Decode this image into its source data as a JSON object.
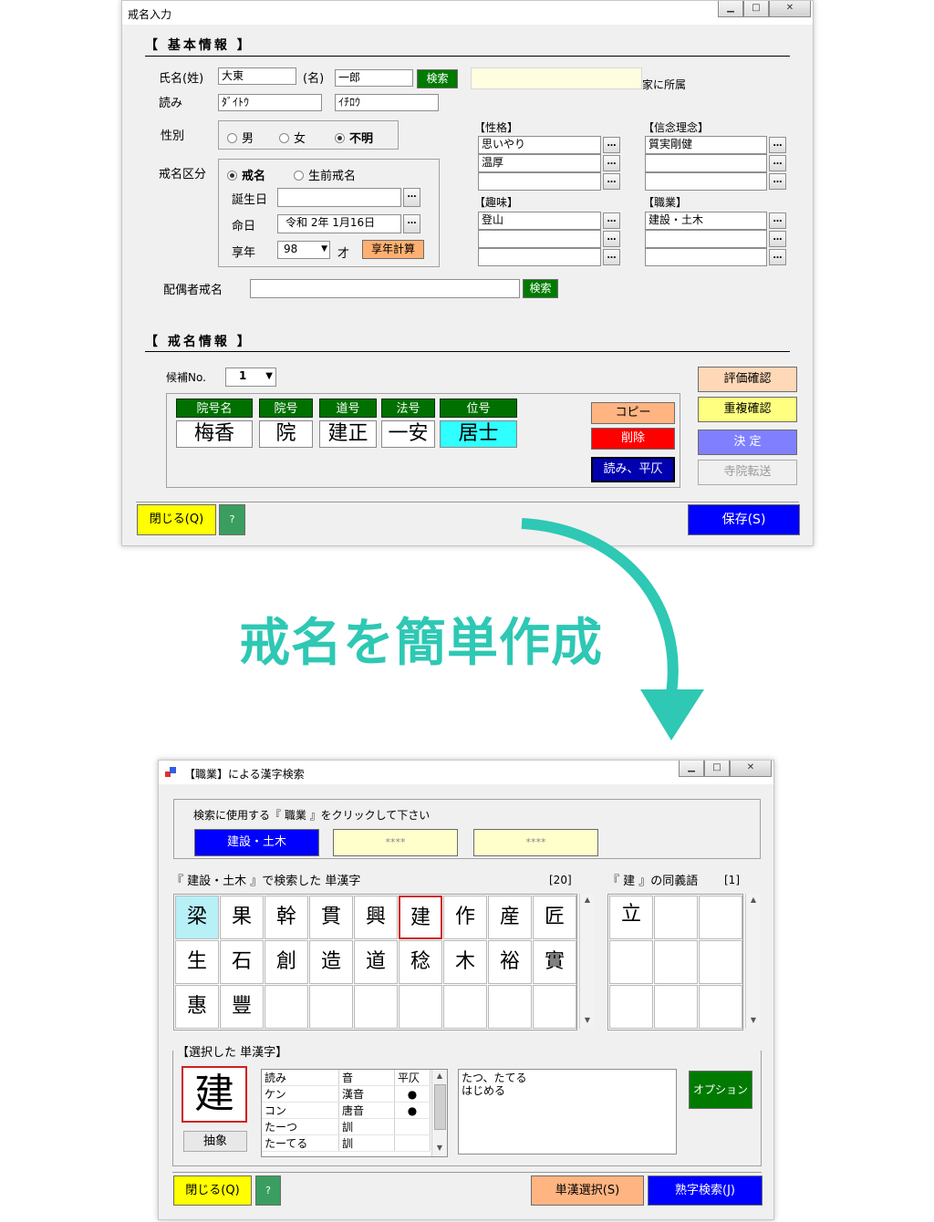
{
  "win1": {
    "title": "戒名入力",
    "basic_section": "【 基本情報 】",
    "name_label": "氏名(姓)",
    "surname": "大東",
    "given_label": "(名)",
    "given": "一郎",
    "search_label": "検索",
    "family_belong_suffix": "家に所属",
    "yomi_label": "読み",
    "surname_yomi": "ﾀﾞｲﾄｳ",
    "given_yomi": "ｲﾁﾛｳ",
    "gender_label": "性別",
    "gender_options": [
      "男",
      "女",
      "不明"
    ],
    "kaimyo_type_label": "戒名区分",
    "kaimyo_type_options": [
      "戒名",
      "生前戒名"
    ],
    "birthday_label": "誕生日",
    "birthday": "",
    "death_label": "命日",
    "death_date": "令和 2年 1月16日",
    "age_label": "享年",
    "age": "98",
    "age_unit": "才",
    "age_calc_label": "享年計算",
    "spouse_label": "配偶者戒名",
    "spouse_value": "",
    "seikaku_label": "【性格】",
    "seikaku": [
      "思いやり",
      "温厚",
      ""
    ],
    "shinnen_label": "【信念理念】",
    "shinnen": [
      "質実剛健",
      "",
      ""
    ],
    "shumi_label": "【趣味】",
    "shumi": [
      "登山",
      "",
      ""
    ],
    "shokugyo_label": "【職業】",
    "shokugyo": [
      "建設・土木",
      "",
      ""
    ],
    "ellipsis": "…",
    "kaimyo_section": "【 戒名情報 】",
    "candidate_label": "候補No.",
    "candidate_value": "1",
    "columns": [
      "院号名",
      "院号",
      "道号",
      "法号",
      "位号"
    ],
    "kaimyo_values": [
      "梅香",
      "院",
      "建正",
      "一安",
      "居士"
    ],
    "copy_label": "コピー",
    "delete_label": "削除",
    "yomi_heisoku_label": "読み、平仄",
    "eval_label": "評価確認",
    "dup_label": "重複確認",
    "decide_label": "決 定",
    "transfer_label": "寺院転送",
    "close_label": "閉じる(Q)",
    "help_label": "?",
    "save_label": "保存(S)"
  },
  "banner": {
    "text": "戒名を簡単作成",
    "color": "#2ec8b4"
  },
  "win2": {
    "title": "【職業】による漢字検索",
    "instruction": "検索に使用する『 職業 』をクリックして下さい",
    "choice1": "建設・土木",
    "choice2": "****",
    "choice3": "****",
    "result_caption": "『 建設・土木 』で検索した 単漢字",
    "result_count": "[20]",
    "kanji": [
      "梁",
      "果",
      "幹",
      "貫",
      "興",
      "建",
      "作",
      "産",
      "匠",
      "生",
      "石",
      "創",
      "造",
      "道",
      "稔",
      "木",
      "裕",
      "實",
      "惠",
      "豐"
    ],
    "synonym_caption": "『 建 』の同義語",
    "synonym_count": "[1]",
    "synonyms": [
      "立"
    ],
    "selected_caption": "【選択した 単漢字】",
    "selected_kanji": "建",
    "abstract_label": "抽象",
    "table_headers": [
      "読み",
      "音",
      "平仄"
    ],
    "table_rows": [
      {
        "yomi": "ケン",
        "on": "漢音",
        "hei": "●"
      },
      {
        "yomi": "コン",
        "on": "唐音",
        "hei": "●"
      },
      {
        "yomi": "たーつ",
        "on": "訓",
        "hei": ""
      },
      {
        "yomi": "たーてる",
        "on": "訓",
        "hei": ""
      }
    ],
    "meaning_line1": "たつ、たてる",
    "meaning_line2": "はじめる",
    "option_label": "オプション",
    "close_label": "閉じる(Q)",
    "help_label": "?",
    "single_select_label": "単漢選択(S)",
    "jukugo_label": "熟字検索(J)"
  }
}
